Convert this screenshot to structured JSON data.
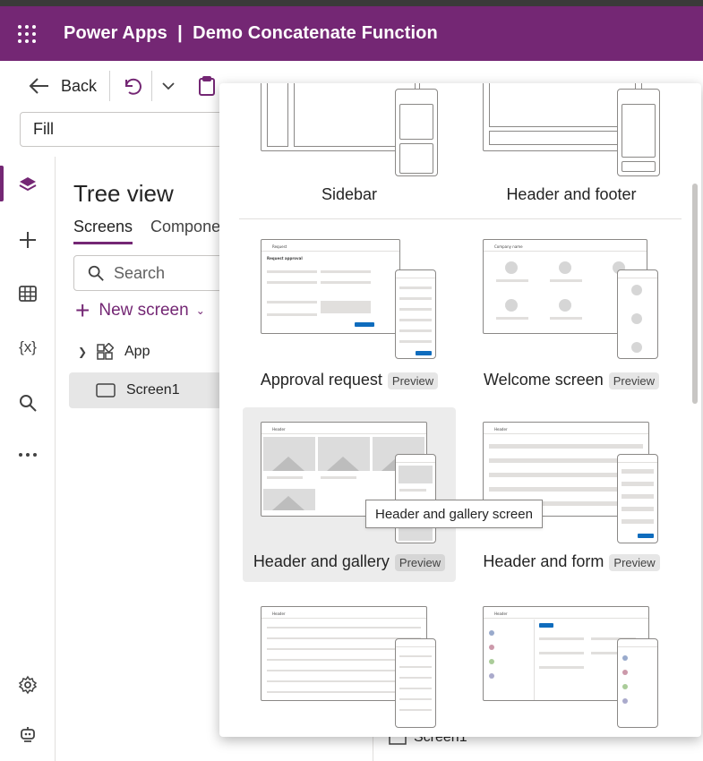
{
  "header": {
    "title": "Power Apps  |  Demo Concatenate Function"
  },
  "commandbar": {
    "back_label": "Back"
  },
  "formula": {
    "property": "Fill"
  },
  "tree": {
    "title": "Tree view",
    "tabs": [
      "Screens",
      "Componen"
    ],
    "search_placeholder": "Search",
    "new_screen_label": "New screen",
    "items": [
      {
        "label": "App",
        "icon": "app-icon"
      },
      {
        "label": "Screen1",
        "icon": "screen-icon"
      }
    ]
  },
  "bottom_screen_label": "Screen1",
  "templates": [
    {
      "label": "Sidebar",
      "badge": ""
    },
    {
      "label": "Header and footer",
      "badge": ""
    },
    {
      "label": "Approval request",
      "badge": "Preview"
    },
    {
      "label": "Welcome screen",
      "badge": "Preview"
    },
    {
      "label": "Header and gallery",
      "badge": "Preview"
    },
    {
      "label": "Header and form",
      "badge": "Preview"
    }
  ],
  "tooltip": "Header and gallery screen",
  "thumb_text": {
    "header": "Header",
    "request": "Request",
    "approval_title": "Request approval",
    "company": "Company name"
  },
  "colors": {
    "brand": "#742774",
    "accent_blue": "#0f6cbd"
  }
}
